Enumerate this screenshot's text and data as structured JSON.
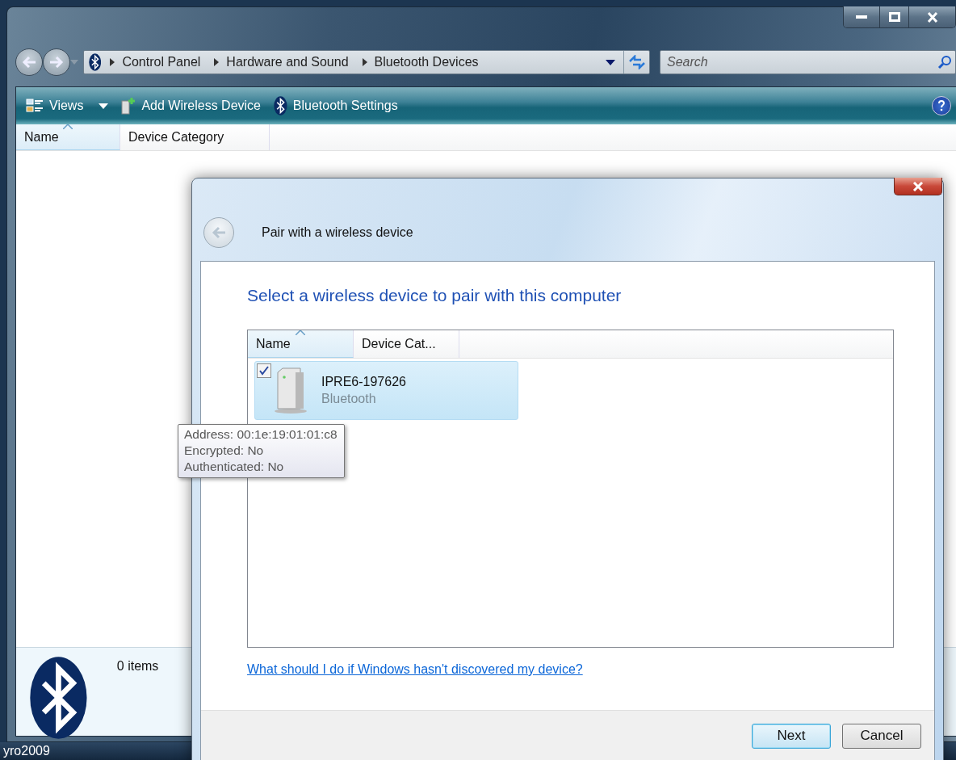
{
  "explorer": {
    "breadcrumb": [
      "Control Panel",
      "Hardware and Sound",
      "Bluetooth Devices"
    ],
    "search": {
      "placeholder": "Search"
    },
    "toolbar": [
      {
        "kind": "views",
        "label": "Views"
      },
      {
        "kind": "add",
        "label": "Add Wireless Device"
      },
      {
        "kind": "bluetooth",
        "label": "Bluetooth Settings"
      }
    ],
    "columns": [
      {
        "label": "Name",
        "sorted": true
      },
      {
        "label": "Device Category",
        "sorted": false
      }
    ],
    "details": {
      "count": "0 items"
    },
    "taskbar": {
      "label": "yro2009"
    }
  },
  "dialog": {
    "title": "Pair with a wireless device",
    "heading": "Select a wireless device to pair with this computer",
    "columns": [
      {
        "label": "Name",
        "sorted": true
      },
      {
        "label": "Device Cat...",
        "sorted": false
      }
    ],
    "devices": [
      {
        "name": "IPRE6-197626",
        "category": "Bluetooth",
        "selected": true,
        "checked": true
      }
    ],
    "tooltip": [
      "Address: 00:1e:19:01:01:c8",
      "Encrypted: No",
      "Authenticated: No"
    ],
    "link": "What should I do if Windows hasn't discovered my device?",
    "buttons": [
      {
        "label": "Next",
        "default": true
      },
      {
        "label": "Cancel",
        "default": false
      }
    ]
  }
}
